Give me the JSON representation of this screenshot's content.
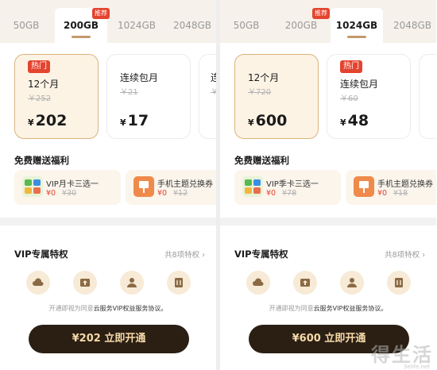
{
  "left": {
    "tabs": [
      {
        "label": "50GB",
        "active": false
      },
      {
        "label": "200GB",
        "active": true
      },
      {
        "label": "1024GB",
        "active": false
      },
      {
        "label": "2048GB",
        "active": false
      }
    ],
    "tab_badge": "推荐",
    "plans": [
      {
        "hot": "热门",
        "name": "12个月",
        "original": "￥252",
        "currency": "¥",
        "price": "202",
        "selected": true
      },
      {
        "hot": "",
        "name": "连续包月",
        "original": "￥21",
        "currency": "¥",
        "price": "17",
        "selected": false
      },
      {
        "hot": "",
        "name": "连",
        "original": "￥",
        "currency": "",
        "price": "",
        "selected": false
      }
    ],
    "gift_title": "免费赠送福利",
    "gifts": [
      {
        "name": "VIP月卡三选一",
        "new_price": "¥0",
        "old_price": "¥30"
      },
      {
        "name": "手机主题兑换券",
        "new_price": "¥0",
        "old_price": "¥12"
      }
    ],
    "vip_title": "VIP专属特权",
    "vip_more": "共8项特权",
    "agreement_prefix": "开通即视为同意",
    "agreement_link": "云服务VIP权益服务协议。",
    "pay_button": "¥202  立即开通"
  },
  "right": {
    "tabs": [
      {
        "label": "50GB",
        "active": false
      },
      {
        "label": "200GB",
        "active": false
      },
      {
        "label": "1024GB",
        "active": true
      },
      {
        "label": "2048GB",
        "active": false
      }
    ],
    "tab_badge": "推荐",
    "plans": [
      {
        "hot": "",
        "name": "12个月",
        "original": "￥720",
        "currency": "¥",
        "price": "600",
        "selected": true
      },
      {
        "hot": "热门",
        "name": "连续包月",
        "original": "￥60",
        "currency": "¥",
        "price": "48",
        "selected": false
      },
      {
        "hot": "",
        "name": "",
        "original": "",
        "currency": "",
        "price": "",
        "selected": false
      }
    ],
    "gift_title": "免费赠送福利",
    "gifts": [
      {
        "name": "VIP季卡三选一",
        "new_price": "¥0",
        "old_price": "¥78"
      },
      {
        "name": "手机主题兑换券",
        "new_price": "¥0",
        "old_price": "¥18"
      }
    ],
    "vip_title": "VIP专属特权",
    "vip_more": "共8项特权",
    "agreement_prefix": "开通即视为同意",
    "agreement_link": "云服务VIP权益服务协议。",
    "pay_button": "¥600  立即开通"
  },
  "watermark": {
    "text": "得生活",
    "url": "3elife.net"
  },
  "colors": {
    "accent": "#c39a6b",
    "hot": "#e4442f",
    "button": "#2b1f14",
    "button_text": "#f5d9a9",
    "selected_card": "#fcf3e5"
  }
}
